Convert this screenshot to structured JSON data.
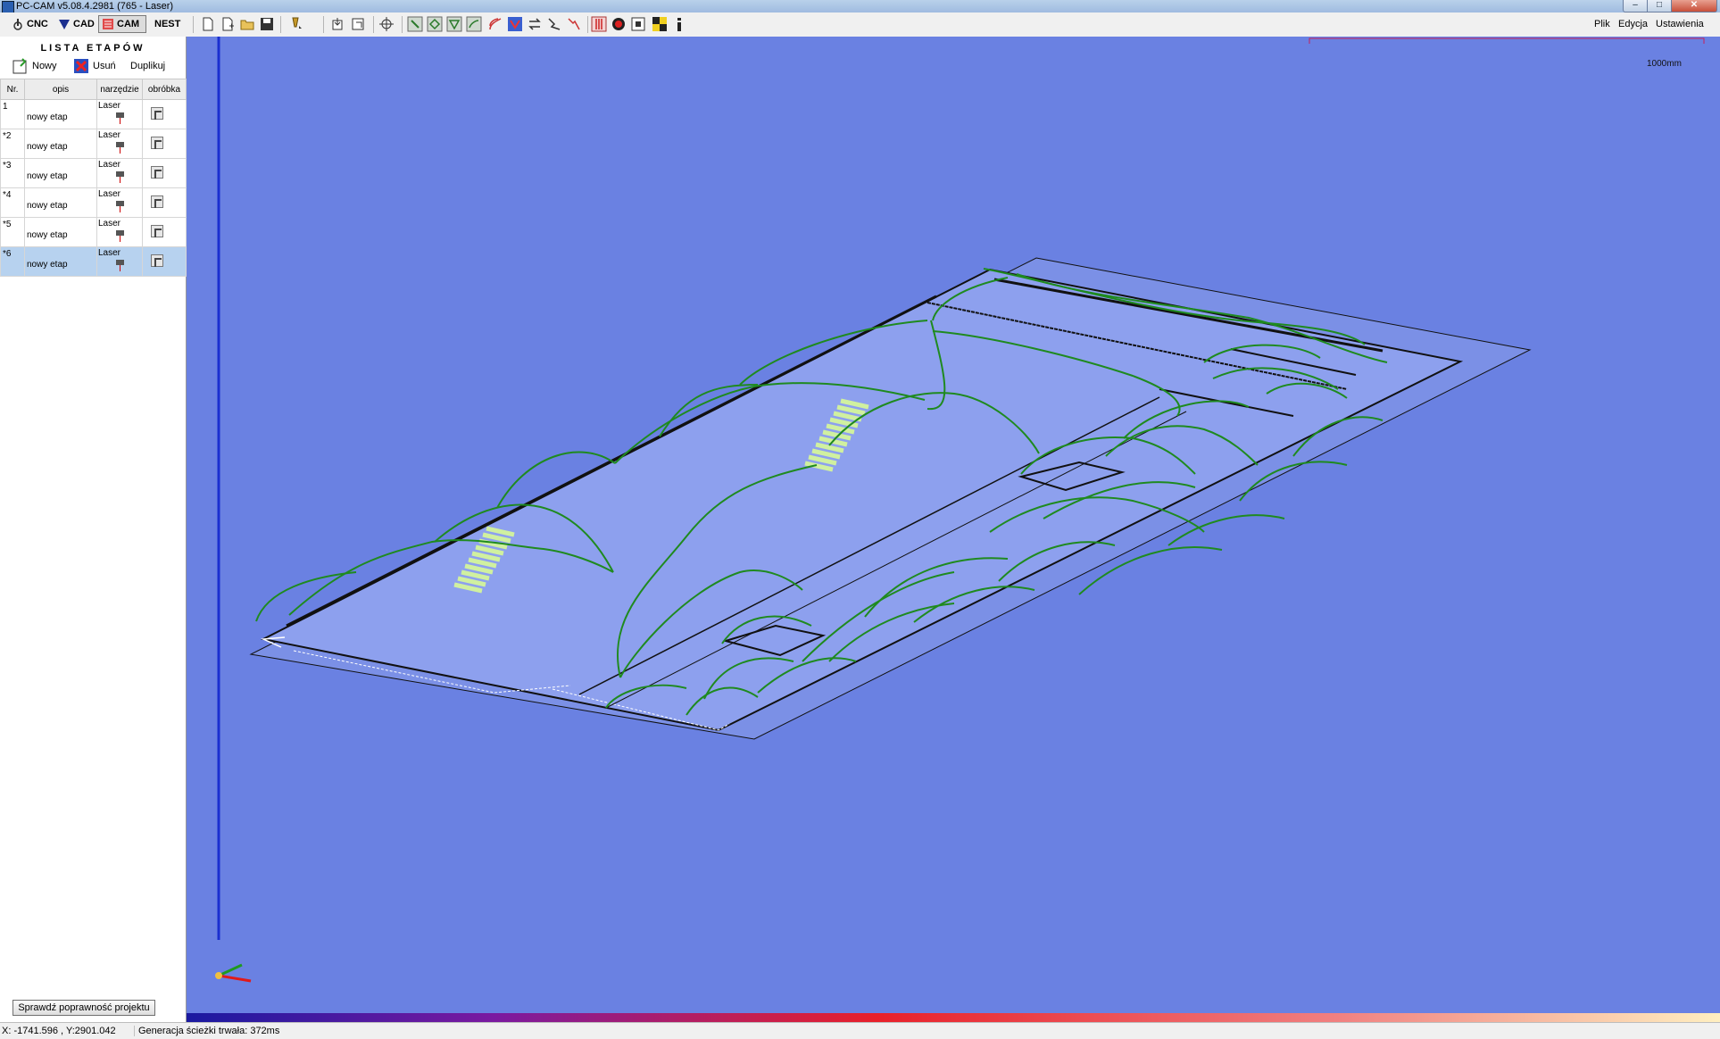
{
  "window": {
    "title": "PC-CAM v5.08.4.2981 (765 - Laser)"
  },
  "modes": [
    {
      "label": "CNC",
      "icon": "cnc-icon"
    },
    {
      "label": "CAD",
      "icon": "cad-icon"
    },
    {
      "label": "CAM",
      "icon": "cam-icon",
      "active": true
    },
    {
      "label": "NEST",
      "icon": ""
    }
  ],
  "toolbar_icons": [
    "new-file-icon",
    "new-from-template-icon",
    "open-folder-icon",
    "save-icon",
    "tool-icon",
    "import-icon",
    "export-icon",
    "origin-icon",
    "stage-icon-1",
    "stage-icon-2",
    "stage-icon-3",
    "stage-icon-4",
    "stage-icon-5",
    "generate-path-icon",
    "swap-icon",
    "reverse-icon",
    "optimize-icon",
    "sequence-icon",
    "play-icon",
    "stop-icon",
    "checker-icon",
    "info-icon"
  ],
  "menu": {
    "file": "Plik",
    "edit": "Edycja",
    "settings": "Ustawienia"
  },
  "panel": {
    "title": "LISTA ETAPÓW",
    "actions": {
      "new": "Nowy",
      "delete": "Usuń",
      "duplicate": "Duplikuj"
    },
    "columns": [
      "Nr.",
      "opis",
      "narzędzie",
      "obróbka"
    ],
    "rows": [
      {
        "nr": "1",
        "opis": "nowy etap",
        "tool": "Laser"
      },
      {
        "nr": "*2",
        "opis": "nowy etap",
        "tool": "Laser"
      },
      {
        "nr": "*3",
        "opis": "nowy etap",
        "tool": "Laser"
      },
      {
        "nr": "*4",
        "opis": "nowy etap",
        "tool": "Laser"
      },
      {
        "nr": "*5",
        "opis": "nowy etap",
        "tool": "Laser"
      },
      {
        "nr": "*6",
        "opis": "nowy etap",
        "tool": "Laser",
        "selected": true
      }
    ],
    "verify_button": "Sprawdź poprawność projektu"
  },
  "viewport": {
    "scale_label": "1000mm",
    "background": "#6a81e2",
    "path_color": "#1f8a1f"
  },
  "status": {
    "coords": "X: -1741.596 , Y:2901.042",
    "message": "Generacja ścieżki trwała: 372ms"
  }
}
